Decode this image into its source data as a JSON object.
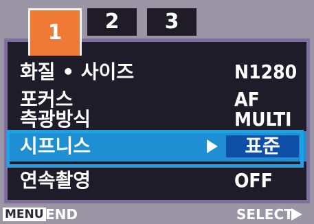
{
  "tabs": [
    {
      "label": "1",
      "active": true
    },
    {
      "label": "2",
      "active": false
    },
    {
      "label": "3",
      "active": false
    }
  ],
  "menu": [
    {
      "label": "화질 • 사이즈",
      "value": "N1280"
    },
    {
      "label": "포커스",
      "value": "AF"
    },
    {
      "label": "측광방식",
      "value": "MULTI"
    },
    {
      "label": "시프니스",
      "value": "표준",
      "selected": true
    },
    {
      "label": "연속촬영",
      "value": "OFF"
    }
  ],
  "footer": {
    "menu_key": "MENU",
    "end_label": "END",
    "select_label": "SELECT"
  },
  "colors": {
    "active_tab": "#ef7a36",
    "panel_bg": "#1f1c29",
    "highlight": "#1f8fd4",
    "selection_frame": "#1aa3e8",
    "value_box": "#0f4fa8"
  },
  "icons": {
    "row_arrow": "play-right-icon",
    "select_arrow": "play-right-icon"
  }
}
